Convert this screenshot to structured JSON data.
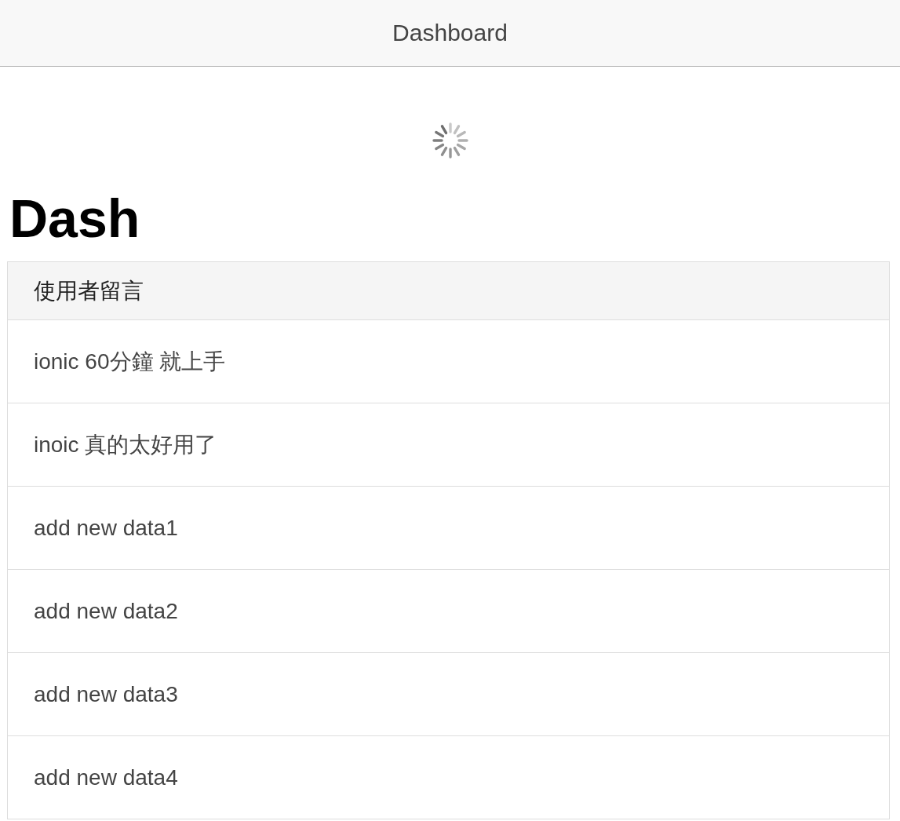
{
  "header": {
    "title": "Dashboard"
  },
  "heading": "Dash",
  "list": {
    "title": "使用者留言",
    "items": [
      "ionic 60分鐘 就上手",
      "inoic 真的太好用了",
      "add new data1",
      "add new data2",
      "add new data3",
      "add new data4"
    ]
  }
}
